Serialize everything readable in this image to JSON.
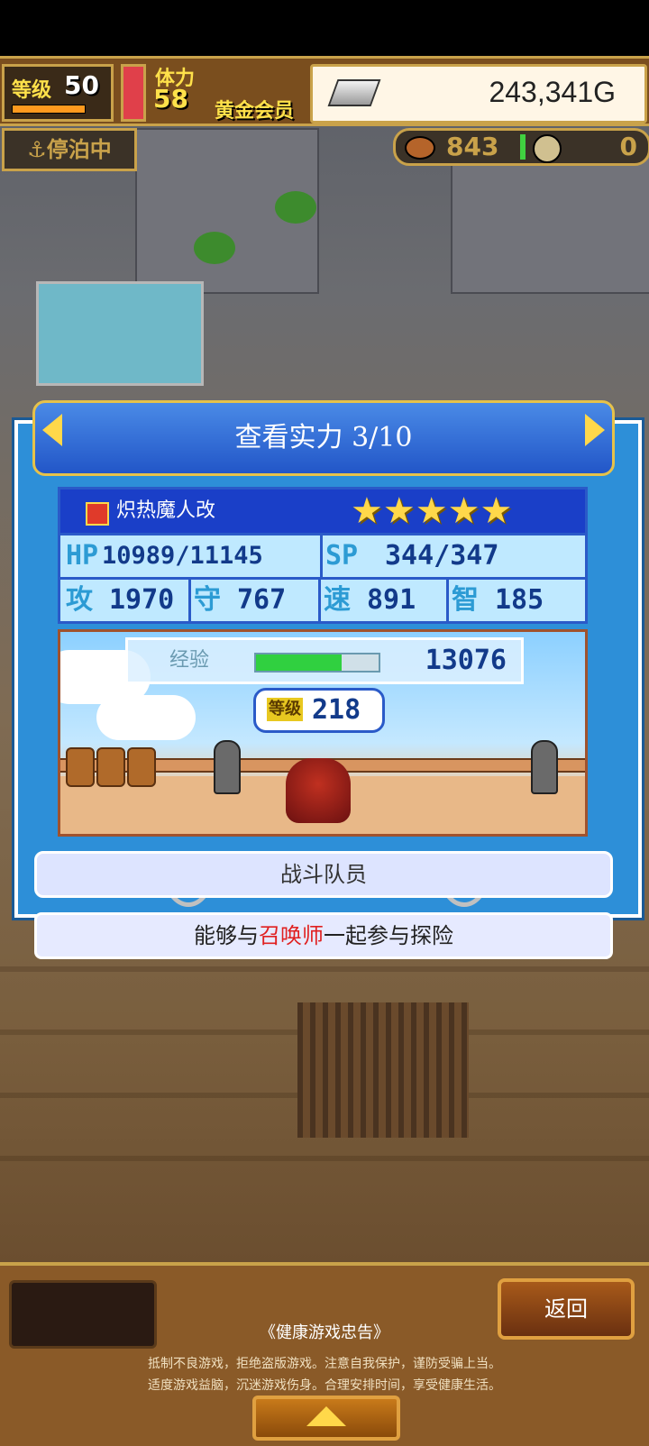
{
  "hud": {
    "level_label": "等级",
    "level_value": "50",
    "stamina_label": "体力",
    "stamina_value": "58",
    "member_label": "黄金会员",
    "gold_amount": "243,341G",
    "moored_label": "停泊中",
    "food_count": "843",
    "medal_count": "0"
  },
  "dialog": {
    "title": "查看实力 3/10",
    "monster": {
      "name": "炽热魔人改",
      "stars": [
        "★",
        "★",
        "★",
        "★",
        "★"
      ],
      "hp_label": "HP",
      "hp": "10989/11145",
      "sp_label": "SP",
      "sp": "344/347",
      "atk_label": "攻",
      "atk": "1970",
      "def_label": "守",
      "def": "767",
      "spd_label": "速",
      "spd": "891",
      "int_label": "智",
      "int": "185"
    },
    "exp_label": "经验",
    "exp_value": "13076",
    "exp_fill": 0.7,
    "level_tag": "等级",
    "level_value": "218",
    "crew_label": "战斗队员",
    "desc_pre": "能够与",
    "desc_highlight": "召唤师",
    "desc_post": "一起参与探险"
  },
  "bottom": {
    "back_label": "返回",
    "notice_title": "《健康游戏忠告》",
    "notice_line1": "抵制不良游戏，拒绝盗版游戏。注意自我保护，谨防受骗上当。",
    "notice_line2": "适度游戏益脑，沉迷游戏伤身。合理安排时间，享受健康生活。"
  },
  "colors": {
    "accent_gold": "#c9a24a",
    "dialog_blue": "#2d8fd8",
    "highlight_red": "#e02020"
  }
}
